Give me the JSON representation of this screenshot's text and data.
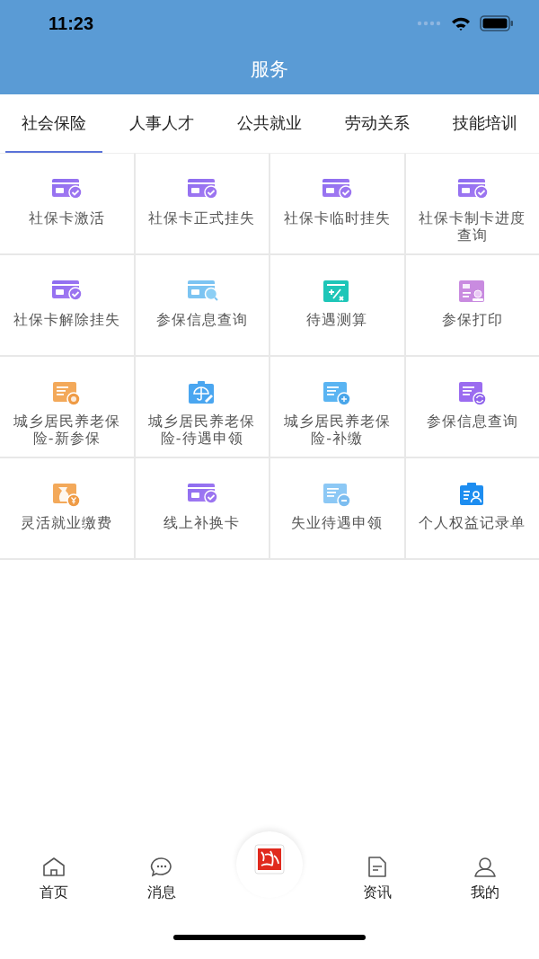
{
  "status_bar": {
    "time": "11:23"
  },
  "header": {
    "title": "服务"
  },
  "tabs": [
    {
      "label": "社会保险",
      "selected": true
    },
    {
      "label": "人事人才",
      "selected": false
    },
    {
      "label": "公共就业",
      "selected": false
    },
    {
      "label": "劳动关系",
      "selected": false
    },
    {
      "label": "技能培训",
      "selected": false
    }
  ],
  "services": [
    {
      "label": "社保卡激活",
      "kind": "card"
    },
    {
      "label": "社保卡正式挂失",
      "kind": "card"
    },
    {
      "label": "社保卡临时挂失",
      "kind": "card"
    },
    {
      "label": "社保卡制卡进度查询",
      "kind": "card"
    },
    {
      "label": "社保卡解除挂失",
      "kind": "card"
    },
    {
      "label": "参保信息查询",
      "kind": "cardsearch"
    },
    {
      "label": "待遇测算",
      "kind": "calc"
    },
    {
      "label": "参保打印",
      "kind": "print"
    },
    {
      "label": "城乡居民养老保险-新参保",
      "kind": "docorange"
    },
    {
      "label": "城乡居民养老保险-待遇申领",
      "kind": "umbrella"
    },
    {
      "label": "城乡居民养老保险-补缴",
      "kind": "docblue"
    },
    {
      "label": "参保信息查询",
      "kind": "docrefresh"
    },
    {
      "label": "灵活就业缴费",
      "kind": "money"
    },
    {
      "label": "线上补换卡",
      "kind": "card"
    },
    {
      "label": "失业待遇申领",
      "kind": "doclight"
    },
    {
      "label": "个人权益记录单",
      "kind": "badge"
    }
  ],
  "bottom_nav": [
    {
      "label": "首页",
      "kind": "home"
    },
    {
      "label": "消息",
      "kind": "chat"
    },
    {
      "kind": "logo"
    },
    {
      "label": "资讯",
      "kind": "news"
    },
    {
      "label": "我的",
      "kind": "user"
    }
  ]
}
